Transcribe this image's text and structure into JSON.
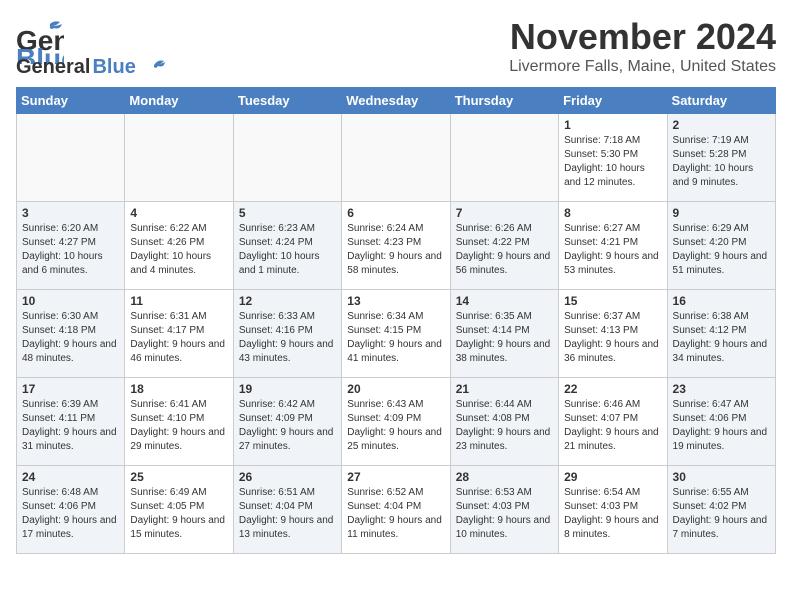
{
  "header": {
    "logo_line1": "General",
    "logo_line2": "Blue",
    "month": "November 2024",
    "location": "Livermore Falls, Maine, United States"
  },
  "weekdays": [
    "Sunday",
    "Monday",
    "Tuesday",
    "Wednesday",
    "Thursday",
    "Friday",
    "Saturday"
  ],
  "rows": [
    [
      {
        "day": "",
        "info": ""
      },
      {
        "day": "",
        "info": ""
      },
      {
        "day": "",
        "info": ""
      },
      {
        "day": "",
        "info": ""
      },
      {
        "day": "",
        "info": ""
      },
      {
        "day": "1",
        "info": "Sunrise: 7:18 AM\nSunset: 5:30 PM\nDaylight: 10 hours and 12 minutes."
      },
      {
        "day": "2",
        "info": "Sunrise: 7:19 AM\nSunset: 5:28 PM\nDaylight: 10 hours and 9 minutes."
      }
    ],
    [
      {
        "day": "3",
        "info": "Sunrise: 6:20 AM\nSunset: 4:27 PM\nDaylight: 10 hours and 6 minutes."
      },
      {
        "day": "4",
        "info": "Sunrise: 6:22 AM\nSunset: 4:26 PM\nDaylight: 10 hours and 4 minutes."
      },
      {
        "day": "5",
        "info": "Sunrise: 6:23 AM\nSunset: 4:24 PM\nDaylight: 10 hours and 1 minute."
      },
      {
        "day": "6",
        "info": "Sunrise: 6:24 AM\nSunset: 4:23 PM\nDaylight: 9 hours and 58 minutes."
      },
      {
        "day": "7",
        "info": "Sunrise: 6:26 AM\nSunset: 4:22 PM\nDaylight: 9 hours and 56 minutes."
      },
      {
        "day": "8",
        "info": "Sunrise: 6:27 AM\nSunset: 4:21 PM\nDaylight: 9 hours and 53 minutes."
      },
      {
        "day": "9",
        "info": "Sunrise: 6:29 AM\nSunset: 4:20 PM\nDaylight: 9 hours and 51 minutes."
      }
    ],
    [
      {
        "day": "10",
        "info": "Sunrise: 6:30 AM\nSunset: 4:18 PM\nDaylight: 9 hours and 48 minutes."
      },
      {
        "day": "11",
        "info": "Sunrise: 6:31 AM\nSunset: 4:17 PM\nDaylight: 9 hours and 46 minutes."
      },
      {
        "day": "12",
        "info": "Sunrise: 6:33 AM\nSunset: 4:16 PM\nDaylight: 9 hours and 43 minutes."
      },
      {
        "day": "13",
        "info": "Sunrise: 6:34 AM\nSunset: 4:15 PM\nDaylight: 9 hours and 41 minutes."
      },
      {
        "day": "14",
        "info": "Sunrise: 6:35 AM\nSunset: 4:14 PM\nDaylight: 9 hours and 38 minutes."
      },
      {
        "day": "15",
        "info": "Sunrise: 6:37 AM\nSunset: 4:13 PM\nDaylight: 9 hours and 36 minutes."
      },
      {
        "day": "16",
        "info": "Sunrise: 6:38 AM\nSunset: 4:12 PM\nDaylight: 9 hours and 34 minutes."
      }
    ],
    [
      {
        "day": "17",
        "info": "Sunrise: 6:39 AM\nSunset: 4:11 PM\nDaylight: 9 hours and 31 minutes."
      },
      {
        "day": "18",
        "info": "Sunrise: 6:41 AM\nSunset: 4:10 PM\nDaylight: 9 hours and 29 minutes."
      },
      {
        "day": "19",
        "info": "Sunrise: 6:42 AM\nSunset: 4:09 PM\nDaylight: 9 hours and 27 minutes."
      },
      {
        "day": "20",
        "info": "Sunrise: 6:43 AM\nSunset: 4:09 PM\nDaylight: 9 hours and 25 minutes."
      },
      {
        "day": "21",
        "info": "Sunrise: 6:44 AM\nSunset: 4:08 PM\nDaylight: 9 hours and 23 minutes."
      },
      {
        "day": "22",
        "info": "Sunrise: 6:46 AM\nSunset: 4:07 PM\nDaylight: 9 hours and 21 minutes."
      },
      {
        "day": "23",
        "info": "Sunrise: 6:47 AM\nSunset: 4:06 PM\nDaylight: 9 hours and 19 minutes."
      }
    ],
    [
      {
        "day": "24",
        "info": "Sunrise: 6:48 AM\nSunset: 4:06 PM\nDaylight: 9 hours and 17 minutes."
      },
      {
        "day": "25",
        "info": "Sunrise: 6:49 AM\nSunset: 4:05 PM\nDaylight: 9 hours and 15 minutes."
      },
      {
        "day": "26",
        "info": "Sunrise: 6:51 AM\nSunset: 4:04 PM\nDaylight: 9 hours and 13 minutes."
      },
      {
        "day": "27",
        "info": "Sunrise: 6:52 AM\nSunset: 4:04 PM\nDaylight: 9 hours and 11 minutes."
      },
      {
        "day": "28",
        "info": "Sunrise: 6:53 AM\nSunset: 4:03 PM\nDaylight: 9 hours and 10 minutes."
      },
      {
        "day": "29",
        "info": "Sunrise: 6:54 AM\nSunset: 4:03 PM\nDaylight: 9 hours and 8 minutes."
      },
      {
        "day": "30",
        "info": "Sunrise: 6:55 AM\nSunset: 4:02 PM\nDaylight: 9 hours and 7 minutes."
      }
    ]
  ]
}
